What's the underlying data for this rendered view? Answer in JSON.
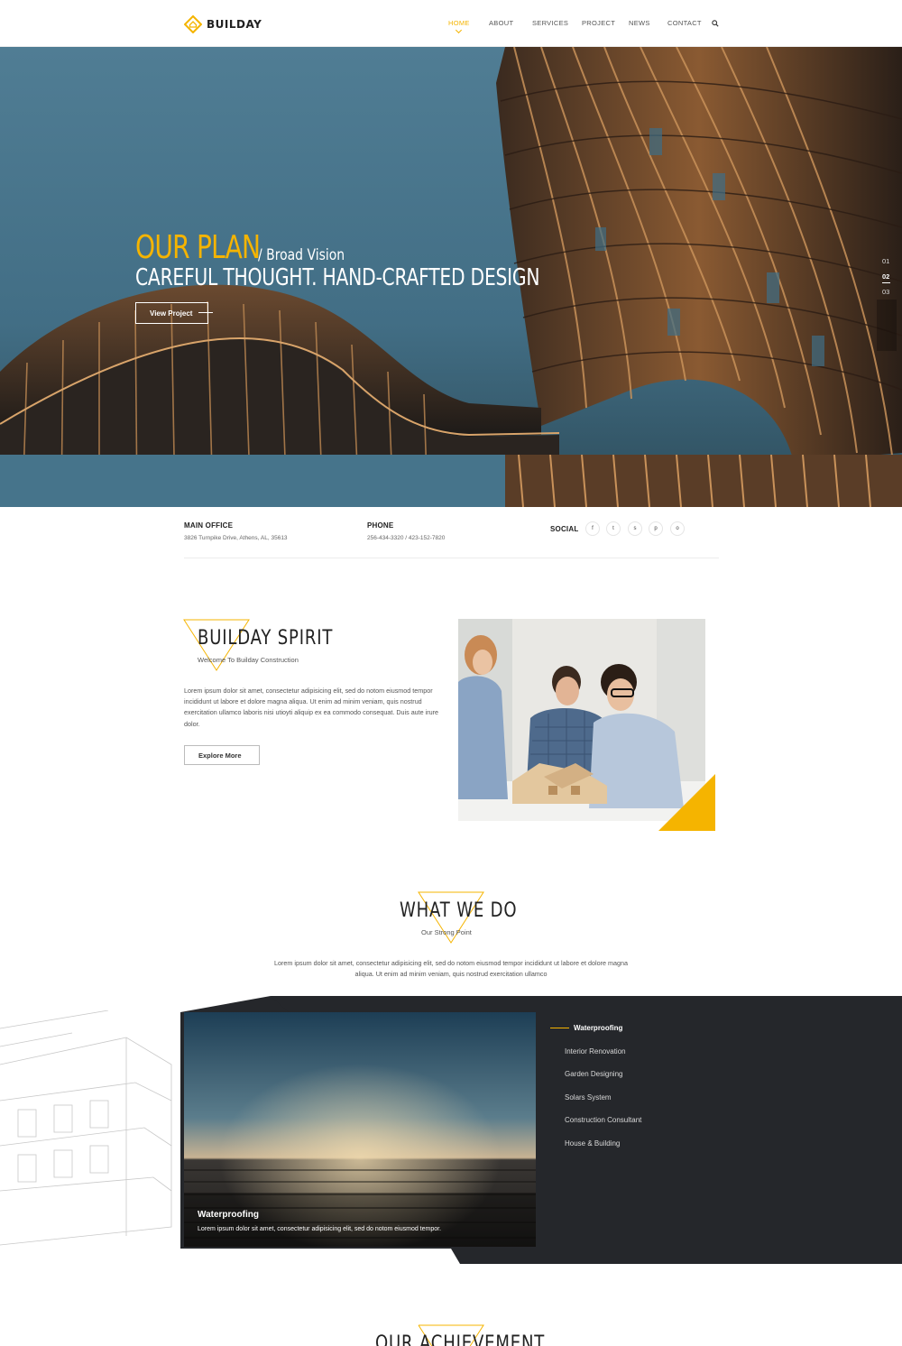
{
  "brand": {
    "name": "BUILDAY",
    "accent": "#f5b400",
    "dark": "#25272b"
  },
  "nav": {
    "items": [
      "HOME",
      "ABOUT",
      "SERVICES",
      "PROJECT",
      "NEWS",
      "CONTACT"
    ],
    "active": "HOME",
    "search_icon": "search-icon"
  },
  "hero": {
    "title": "OUR PLAN",
    "subtitle": "/ Broad Vision",
    "headline": "CAREFUL THOUGHT. HAND-CRAFTED DESIGN",
    "button": "View Project",
    "slides": [
      "01",
      "02",
      "03"
    ],
    "active_slide": "02"
  },
  "info": {
    "office_label": "MAIN OFFICE",
    "office_value": "3826 Turnpike Drive, Athens, AL, 35613",
    "phone_label": "PHONE",
    "phone_value": "256-434-3320 / 423-152-7820",
    "social_label": "SOCIAL",
    "social_icons": [
      "facebook-icon",
      "twitter-icon",
      "skype-icon",
      "pinterest-icon",
      "instagram-icon"
    ],
    "social_glyphs": [
      "f",
      "t",
      "s",
      "p",
      "o"
    ]
  },
  "about": {
    "title": "BUILDAY SPIRIT",
    "subtitle": "Welcome To Builday Construction",
    "text": "Lorem ipsum dolor sit amet, consectetur adipisicing elit, sed do notom eiusmod tempor incididunt ut labore et dolore magna aliqua. Ut enim ad minim veniam, quis nostrud exercitation ullamco laboris nisi utioyti aliquip ex ea commodo consequat. Duis aute irure dolor.",
    "button": "Explore More"
  },
  "services": {
    "title": "WHAT WE DO",
    "subtitle": "Our Strong Point",
    "text": "Lorem ipsum dolor sit amet, consectetur adipisicing elit, sed do notom eiusmod tempor incididunt ut labore et dolore magna aliqua. Ut enim ad minim veniam, quis nostrud exercitation ullamco",
    "items": [
      "Waterproofing",
      "Interior Renovation",
      "Garden Designing",
      "Solars System",
      "Construction Consultant",
      "House & Building"
    ],
    "active": "Waterproofing",
    "caption_title": "Waterproofing",
    "caption_text": "Lorem ipsum dolor sit amet, consectetur adipisicing elit, sed do notom eiusmod tempor."
  },
  "achievement": {
    "title": "OUR ACHIEVEMENT"
  }
}
